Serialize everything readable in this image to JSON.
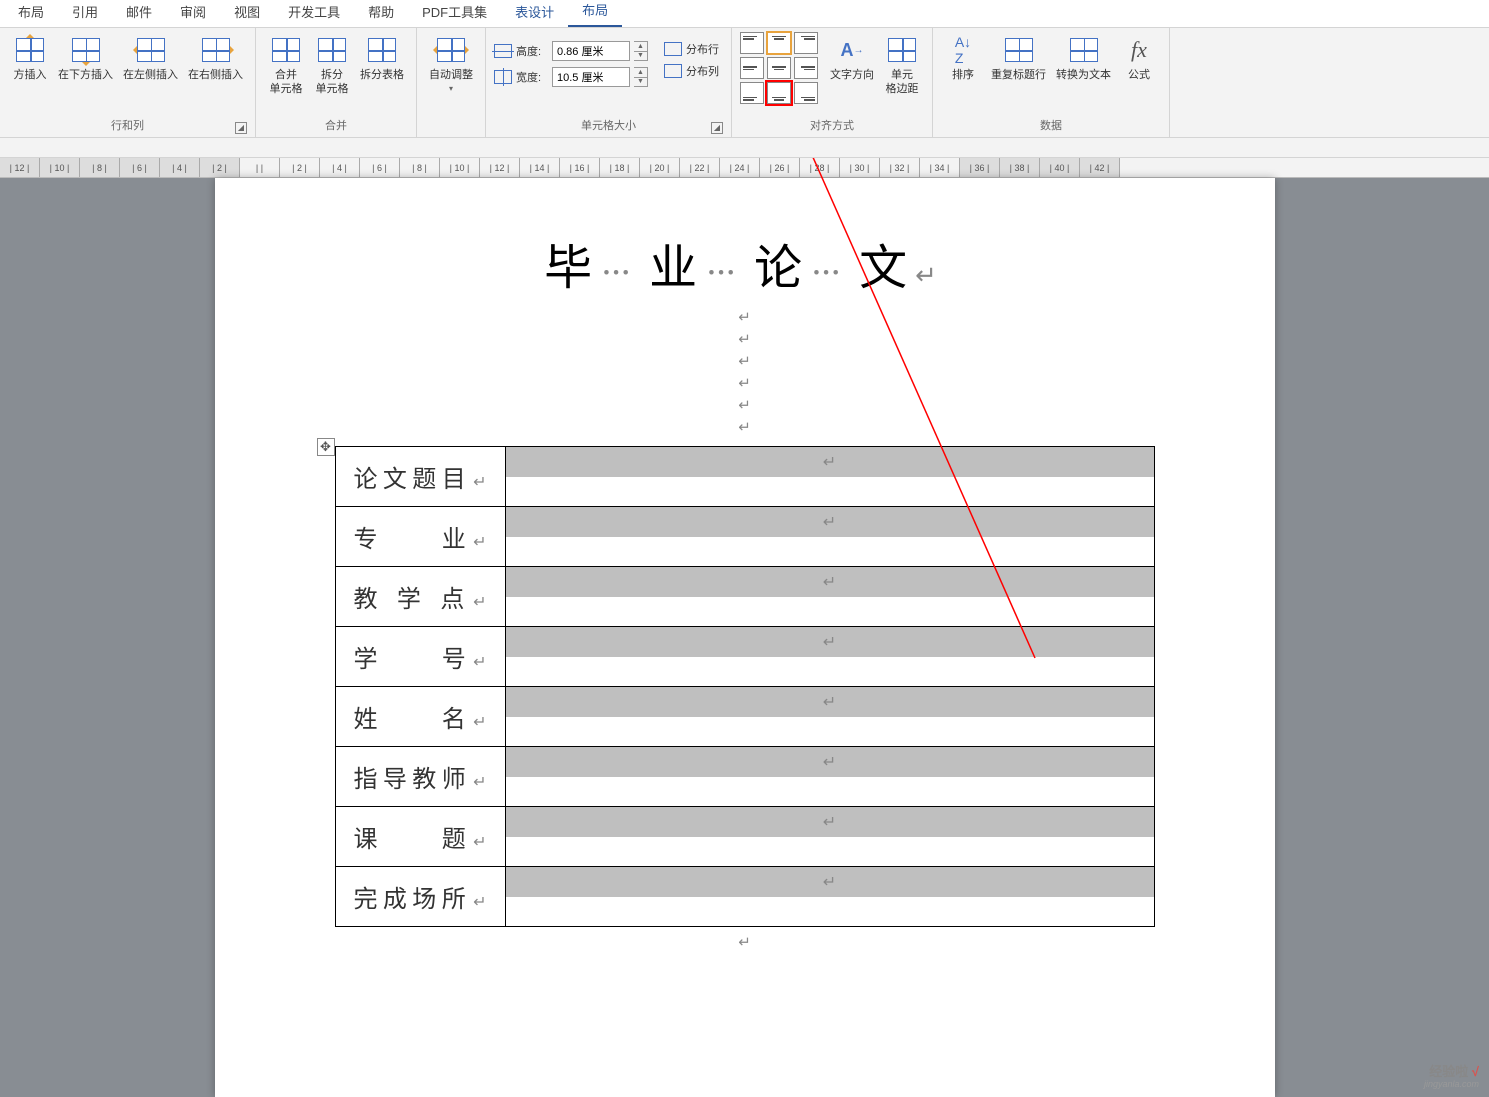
{
  "tabs": {
    "layout_left": "布局",
    "references": "引用",
    "mailings": "邮件",
    "review": "审阅",
    "view": "视图",
    "dev_tools": "开发工具",
    "help": "帮助",
    "pdf_tools": "PDF工具集",
    "table_design": "表设计",
    "layout": "布局"
  },
  "ribbon": {
    "rows_cols": {
      "insert_above": "方插入",
      "insert_below": "在下方插入",
      "insert_left": "在左侧插入",
      "insert_right": "在右侧插入",
      "group": "行和列"
    },
    "merge": {
      "merge_cells_l1": "合并",
      "merge_cells_l2": "单元格",
      "split_cells_l1": "拆分",
      "split_cells_l2": "单元格",
      "split_table": "拆分表格",
      "group": "合并"
    },
    "autofit": {
      "label": "自动调整",
      "group_hidden": ""
    },
    "cell_size": {
      "height_label": "高度:",
      "height_value": "0.86 厘米",
      "width_label": "宽度:",
      "width_value": "10.5 厘米",
      "dist_rows": "分布行",
      "dist_cols": "分布列",
      "group": "单元格大小"
    },
    "alignment": {
      "text_direction": "文字方向",
      "cell_margins_l1": "单元",
      "cell_margins_l2": "格边距",
      "group": "对齐方式"
    },
    "data": {
      "sort": "排序",
      "repeat_header": "重复标题行",
      "convert_text": "转换为文本",
      "formula": "公式",
      "group": "数据"
    }
  },
  "ruler_marks": [
    "12",
    "10",
    "8",
    "6",
    "4",
    "2",
    "",
    "2",
    "4",
    "6",
    "8",
    "10",
    "12",
    "14",
    "16",
    "18",
    "20",
    "22",
    "24",
    "26",
    "28",
    "30",
    "32",
    "34",
    "36",
    "38",
    "40",
    "42"
  ],
  "document": {
    "title_chars": [
      "毕",
      "业",
      "论",
      "文"
    ],
    "return_mark": "↵",
    "table_rows": [
      "论文题目",
      "专　　业",
      "教 学 点",
      "学　　号",
      "姓　　名",
      "指导教师",
      "课　　题",
      "完成场所"
    ],
    "cell_mark": "↵"
  },
  "watermark": {
    "line1_text": "经验啦",
    "line1_check": "√",
    "line2": "jingyanla.com"
  }
}
